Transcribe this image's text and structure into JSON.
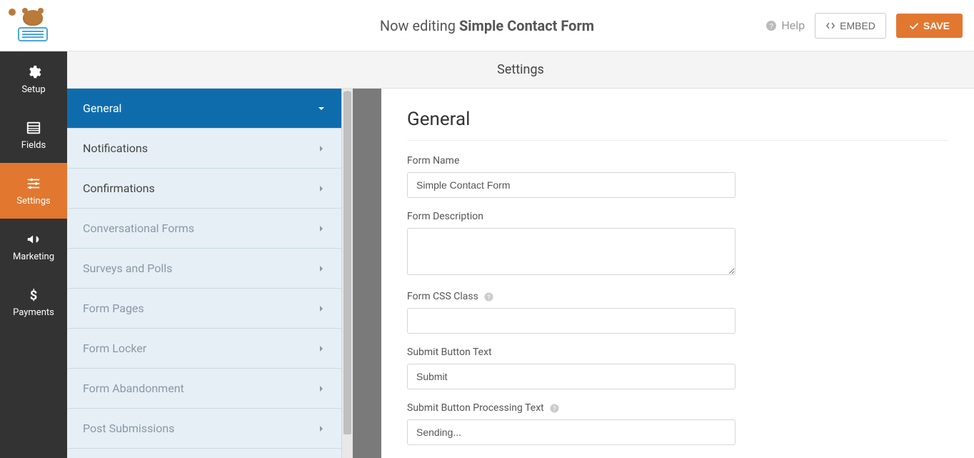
{
  "header": {
    "editing_prefix": "Now editing ",
    "form_name": "Simple Contact Form",
    "help_label": "Help",
    "embed_label": "EMBED",
    "save_label": "SAVE"
  },
  "dark_nav": {
    "items": [
      {
        "key": "setup",
        "label": "Setup"
      },
      {
        "key": "fields",
        "label": "Fields"
      },
      {
        "key": "settings",
        "label": "Settings"
      },
      {
        "key": "marketing",
        "label": "Marketing"
      },
      {
        "key": "payments",
        "label": "Payments"
      }
    ],
    "active": "settings"
  },
  "section_bar": {
    "title": "Settings"
  },
  "submenu": {
    "items": [
      {
        "label": "General",
        "active": true,
        "muted": false
      },
      {
        "label": "Notifications",
        "active": false,
        "muted": false
      },
      {
        "label": "Confirmations",
        "active": false,
        "muted": false
      },
      {
        "label": "Conversational Forms",
        "active": false,
        "muted": true
      },
      {
        "label": "Surveys and Polls",
        "active": false,
        "muted": true
      },
      {
        "label": "Form Pages",
        "active": false,
        "muted": true
      },
      {
        "label": "Form Locker",
        "active": false,
        "muted": true
      },
      {
        "label": "Form Abandonment",
        "active": false,
        "muted": true
      },
      {
        "label": "Post Submissions",
        "active": false,
        "muted": true
      }
    ]
  },
  "form": {
    "heading": "General",
    "fields": {
      "form_name": {
        "label": "Form Name",
        "value": "Simple Contact Form"
      },
      "form_description": {
        "label": "Form Description",
        "value": ""
      },
      "form_css_class": {
        "label": "Form CSS Class",
        "value": "",
        "help": true
      },
      "submit_button_text": {
        "label": "Submit Button Text",
        "value": "Submit"
      },
      "submit_button_processing_text": {
        "label": "Submit Button Processing Text",
        "value": "Sending...",
        "help": true
      }
    }
  }
}
